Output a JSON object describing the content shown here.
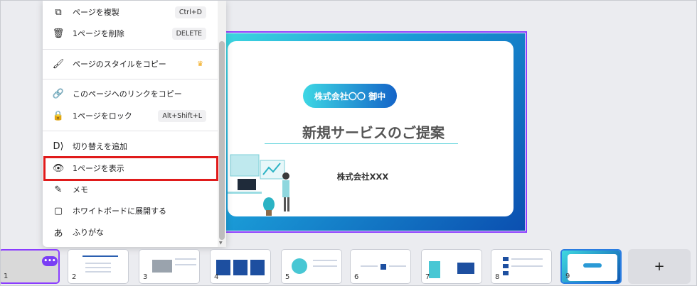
{
  "menu": {
    "items": [
      {
        "icon": "duplicate-icon",
        "glyph": "⧉",
        "label": "ページを複製",
        "shortcut": "Ctrl+D"
      },
      {
        "icon": "trash-icon",
        "glyph": "🗑",
        "label": "1ページを削除",
        "shortcut": "DELETE"
      },
      {
        "icon": "paint-roller-icon",
        "glyph": "🖌",
        "label": "ページのスタイルをコピー",
        "badge": "crown-icon"
      },
      {
        "icon": "link-icon",
        "glyph": "🔗",
        "label": "このページへのリンクをコピー"
      },
      {
        "icon": "lock-icon",
        "glyph": "🔒",
        "label": "1ページをロック",
        "shortcut": "Alt+Shift+L"
      },
      {
        "icon": "transition-icon",
        "glyph": "D⟩",
        "label": "切り替えを追加"
      },
      {
        "icon": "eye-icon",
        "glyph": "👁",
        "label": "1ページを表示"
      },
      {
        "icon": "note-icon",
        "glyph": "✎",
        "label": "メモ"
      },
      {
        "icon": "whiteboard-icon",
        "glyph": "▢",
        "label": "ホワイトボードに展開する"
      },
      {
        "icon": "furigana-icon",
        "glyph": "あ",
        "label": "ふりがな"
      }
    ]
  },
  "slide": {
    "recipient": "株式会社〇〇 御中",
    "title": "新規サービスのご提案",
    "company": "株式会社XXX"
  },
  "thumbnails": {
    "pages": [
      "1",
      "2",
      "3",
      "4",
      "5",
      "6",
      "7",
      "8",
      "9"
    ],
    "more_label": "•••",
    "add_label": "+"
  },
  "colors": {
    "accent": "#8b3dff",
    "highlight": "#e01b1b",
    "slide_gradient_start": "#3fd9e0",
    "slide_gradient_end": "#0b4fb0"
  }
}
